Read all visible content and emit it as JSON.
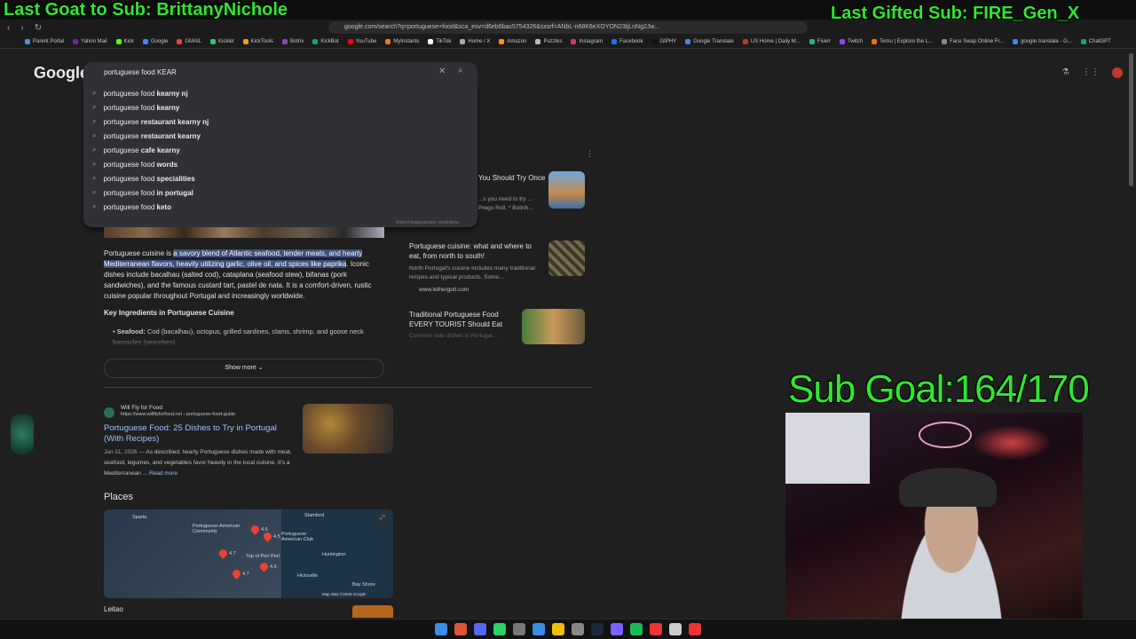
{
  "overlays": {
    "left": "Last Goat to Sub: BrittanyNichole",
    "right": "Last Gifted Sub: FIRE_Gen_X",
    "goal": "Sub Goal:164/170"
  },
  "browser": {
    "url": "google.com/search?q=portuguese+food&sca_esv=d6eb6bac5754326&sxsrf=ANbL-n68K6eXOYON23tjLnNg2Jw...",
    "bookmarks": [
      "Parent Portal",
      "Yahoo Mail",
      "Kick",
      "Google",
      "GMAIL",
      "Kicklet",
      "KickTools",
      "Botrix",
      "KickBot",
      "YouTube",
      "MyInstants",
      "TikTok",
      "Home / X",
      "Amazon",
      "Puzzles",
      "Instagram",
      "Facebook",
      "GIPHY",
      "Google Translate",
      "US Home | Daily M...",
      "Fiverr",
      "Twitch",
      "Temu | Explore the L...",
      "Face Swap Online Fr...",
      "google translate - G...",
      "ChatGPT"
    ]
  },
  "search": {
    "logo": "Google",
    "query": "portuguese food KEAR",
    "suggestions": [
      {
        "base": "portuguese food ",
        "bold": "kearny nj"
      },
      {
        "base": "portuguese food ",
        "bold": "kearny"
      },
      {
        "base": "portuguese ",
        "bold": "restaurant kearny nj"
      },
      {
        "base": "portuguese ",
        "bold": "restaurant kearny"
      },
      {
        "base": "portuguese ",
        "bold": "cafe kearny"
      },
      {
        "base": "portuguese food ",
        "bold": "words"
      },
      {
        "base": "portuguese food ",
        "bold": "specialities"
      },
      {
        "base": "portuguese food ",
        "bold": "in portugal"
      },
      {
        "base": "portuguese food ",
        "bold": "keto"
      }
    ],
    "report": "Report inappropriate predictions"
  },
  "ai": {
    "p_start": "Portuguese cuisine is ",
    "p_hl": "a savory blend of Atlantic seafood, tender meats, and hearty Mediterranean flavors, heavily utilizing garlic, olive oil, and spices like paprika",
    "p_mid": ". Iconic dishes include ",
    "p_rest": "bacalhau (salted cod), cataplana (seafood stew), bifanas (pork sandwiches), and the famous custard tart, pastel de nata. It is a comfort-driven, rustic cuisine popular throughout Portugal and increasingly worldwide.",
    "key_heading": "Key Ingredients in Portuguese Cuisine",
    "seafood_label": "Seafood:",
    "seafood_text": "Cod (bacalhau), octopus, grilled sardines, clams, shrimp, and goose neck barnacles (percebes)",
    "show_more": "Show more"
  },
  "cards": [
    {
      "title": "You Should Try Once",
      "snippet": "...s you need to try ... Prego Roll. * Bolinh..."
    },
    {
      "title": "Portuguese cuisine: what and where to eat, from north to south!",
      "snippet": "North Portugal's cuisine includes many traditional recipes and typical products. Some...",
      "site": "www.lethergoit.com"
    },
    {
      "title": "Traditional Portuguese Food EVERY TOURIST Should Eat",
      "snippet": "Common side dishes in Portugal..."
    }
  ],
  "result": {
    "site": "Will Fly for Food",
    "cite": "https://www.willflyforfood.net › portuguese-food-guide",
    "title": "Portuguese Food: 25 Dishes to Try in Portugal (With Recipes)",
    "date": "Jan 31, 2026 —",
    "snippet": "As described, hearty Portuguese dishes made with meat, seafood, legumes, and vegetables favor heavily in the local cuisine. It's a Mediterranean ...",
    "read_more": "Read more"
  },
  "places": {
    "heading": "Places",
    "map_labels": [
      "Sparta",
      "Portuguese-American Community",
      "Stamford",
      "Portuguese American Club",
      "Top of Perí Perí",
      "Huntington",
      "Bay Shore",
      "Hicksville"
    ],
    "pin_ratings": [
      "4.6",
      "4.5",
      "4.7",
      "4.7",
      "4.6"
    ],
    "map_credit": "Map data ©2026 Google",
    "first": "Leitao"
  },
  "colors": {
    "accent_link": "#99c3ff",
    "highlight": "#3d4f7c",
    "overlay": "#2ee82e"
  }
}
